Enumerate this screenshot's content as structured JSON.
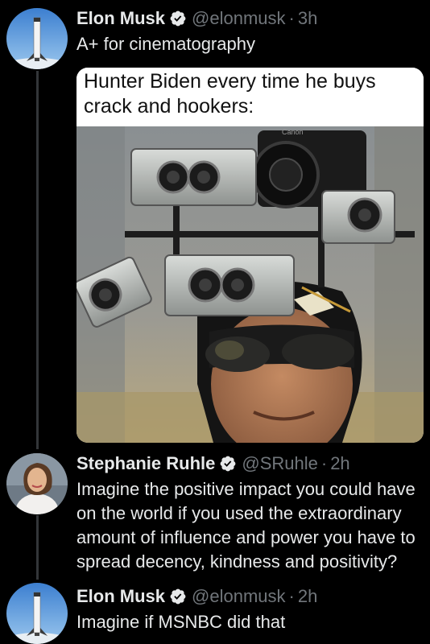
{
  "tweets": [
    {
      "name": "Elon Musk",
      "handle": "@elonmusk",
      "time": "3h",
      "text": "A+ for cinematography",
      "avatar_icon": "rocket-avatar-icon"
    },
    {
      "name": "Stephanie Ruhle",
      "handle": "@SRuhle",
      "time": "2h",
      "text": "Imagine the positive impact you could have on the world if you used the extraordinary amount of influence and power you have to spread decency, kindness and positivity?",
      "avatar_icon": "person-avatar-icon"
    },
    {
      "name": "Elon Musk",
      "handle": "@elonmusk",
      "time": "2h",
      "text": "Imagine if MSNBC did that",
      "avatar_icon": "rocket-avatar-icon"
    }
  ],
  "media": {
    "caption": "Hunter Biden every time he buys crack and hookers:",
    "photo_brand": "Canon"
  },
  "colors": {
    "background": "#000000",
    "text": "#e7e9ea",
    "secondary": "#71767b",
    "verified": "#1d9bf0",
    "thread_line": "#333639"
  }
}
